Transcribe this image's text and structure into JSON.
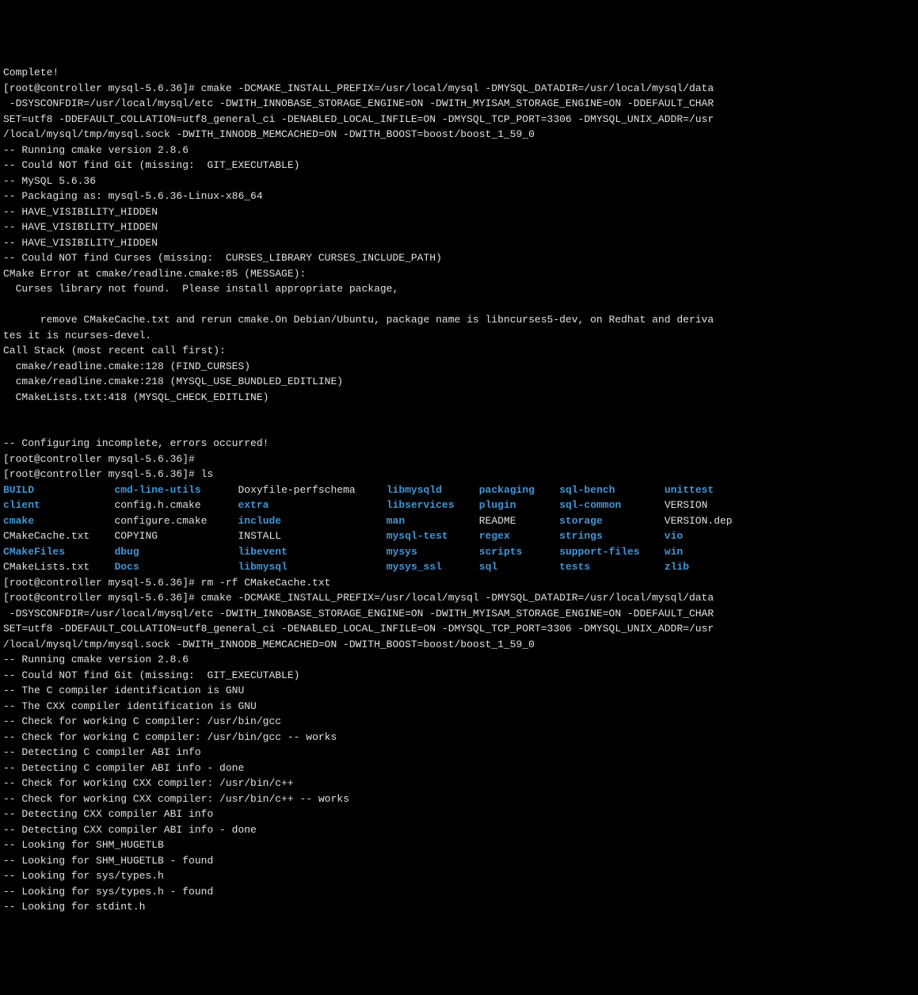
{
  "lines": {
    "l0": "Complete!",
    "l1": "[root@controller mysql-5.6.36]# cmake -DCMAKE_INSTALL_PREFIX=/usr/local/mysql -DMYSQL_DATADIR=/usr/local/mysql/data",
    "l2": " -DSYSCONFDIR=/usr/local/mysql/etc -DWITH_INNOBASE_STORAGE_ENGINE=ON -DWITH_MYISAM_STORAGE_ENGINE=ON -DDEFAULT_CHAR",
    "l3": "SET=utf8 -DDEFAULT_COLLATION=utf8_general_ci -DENABLED_LOCAL_INFILE=ON -DMYSQL_TCP_PORT=3306 -DMYSQL_UNIX_ADDR=/usr",
    "l4": "/local/mysql/tmp/mysql.sock -DWITH_INNODB_MEMCACHED=ON -DWITH_BOOST=boost/boost_1_59_0",
    "l5": "-- Running cmake version 2.8.6",
    "l6": "-- Could NOT find Git (missing:  GIT_EXECUTABLE) ",
    "l7": "-- MySQL 5.6.36",
    "l8": "-- Packaging as: mysql-5.6.36-Linux-x86_64",
    "l9": "-- HAVE_VISIBILITY_HIDDEN",
    "l10": "-- HAVE_VISIBILITY_HIDDEN",
    "l11": "-- HAVE_VISIBILITY_HIDDEN",
    "l12": "-- Could NOT find Curses (missing:  CURSES_LIBRARY CURSES_INCLUDE_PATH) ",
    "l13": "CMake Error at cmake/readline.cmake:85 (MESSAGE):",
    "l14": "  Curses library not found.  Please install appropriate package,",
    "l15": "",
    "l16": "      remove CMakeCache.txt and rerun cmake.On Debian/Ubuntu, package name is libncurses5-dev, on Redhat and deriva",
    "l17": "tes it is ncurses-devel.",
    "l18": "Call Stack (most recent call first):",
    "l19": "  cmake/readline.cmake:128 (FIND_CURSES)",
    "l20": "  cmake/readline.cmake:218 (MYSQL_USE_BUNDLED_EDITLINE)",
    "l21": "  CMakeLists.txt:418 (MYSQL_CHECK_EDITLINE)",
    "l22": "",
    "l23": "",
    "l24": "-- Configuring incomplete, errors occurred!",
    "l25": "[root@controller mysql-5.6.36]# ",
    "l26": "[root@controller mysql-5.6.36]# ls",
    "l27": "[root@controller mysql-5.6.36]# rm -rf CMakeCache.txt ",
    "l28": "[root@controller mysql-5.6.36]# cmake -DCMAKE_INSTALL_PREFIX=/usr/local/mysql -DMYSQL_DATADIR=/usr/local/mysql/data",
    "l29": " -DSYSCONFDIR=/usr/local/mysql/etc -DWITH_INNOBASE_STORAGE_ENGINE=ON -DWITH_MYISAM_STORAGE_ENGINE=ON -DDEFAULT_CHAR",
    "l30": "SET=utf8 -DDEFAULT_COLLATION=utf8_general_ci -DENABLED_LOCAL_INFILE=ON -DMYSQL_TCP_PORT=3306 -DMYSQL_UNIX_ADDR=/usr",
    "l31": "/local/mysql/tmp/mysql.sock -DWITH_INNODB_MEMCACHED=ON -DWITH_BOOST=boost/boost_1_59_0",
    "l32": "-- Running cmake version 2.8.6",
    "l33": "-- Could NOT find Git (missing:  GIT_EXECUTABLE) ",
    "l34": "-- The C compiler identification is GNU",
    "l35": "-- The CXX compiler identification is GNU",
    "l36": "-- Check for working C compiler: /usr/bin/gcc",
    "l37": "-- Check for working C compiler: /usr/bin/gcc -- works",
    "l38": "-- Detecting C compiler ABI info",
    "l39": "-- Detecting C compiler ABI info - done",
    "l40": "-- Check for working CXX compiler: /usr/bin/c++",
    "l41": "-- Check for working CXX compiler: /usr/bin/c++ -- works",
    "l42": "-- Detecting CXX compiler ABI info",
    "l43": "-- Detecting CXX compiler ABI info - done",
    "l44": "-- Looking for SHM_HUGETLB",
    "l45": "-- Looking for SHM_HUGETLB - found",
    "l46": "-- Looking for sys/types.h",
    "l47": "-- Looking for sys/types.h - found",
    "l48": "-- Looking for stdint.h"
  },
  "ls": {
    "r0c0": "BUILD",
    "r0c1": "cmd-line-utils",
    "r0c2": "Doxyfile-perfschema",
    "r0c3": "libmysqld",
    "r0c4": "packaging",
    "r0c5": "sql-bench",
    "r0c6": "unittest",
    "r1c0": "client",
    "r1c1": "config.h.cmake",
    "r1c2": "extra",
    "r1c3": "libservices",
    "r1c4": "plugin",
    "r1c5": "sql-common",
    "r1c6": "VERSION",
    "r2c0": "cmake",
    "r2c1": "configure.cmake",
    "r2c2": "include",
    "r2c3": "man",
    "r2c4": "README",
    "r2c5": "storage",
    "r2c6": "VERSION.dep",
    "r3c0": "CMakeCache.txt",
    "r3c1": "COPYING",
    "r3c2": "INSTALL",
    "r3c3": "mysql-test",
    "r3c4": "regex",
    "r3c5": "strings",
    "r3c6": "vio",
    "r4c0": "CMakeFiles",
    "r4c1": "dbug",
    "r4c2": "libevent",
    "r4c3": "mysys",
    "r4c4": "scripts",
    "r4c5": "support-files",
    "r4c6": "win",
    "r5c0": "CMakeLists.txt",
    "r5c1": "Docs",
    "r5c2": "libmysql",
    "r5c3": "mysys_ssl",
    "r5c4": "sql",
    "r5c5": "tests",
    "r5c6": "zlib"
  },
  "ls_types": {
    "r0c0": "d",
    "r0c1": "d",
    "r0c2": "f",
    "r0c3": "d",
    "r0c4": "d",
    "r0c5": "d",
    "r0c6": "d",
    "r1c0": "d",
    "r1c1": "f",
    "r1c2": "d",
    "r1c3": "d",
    "r1c4": "d",
    "r1c5": "d",
    "r1c6": "f",
    "r2c0": "d",
    "r2c1": "f",
    "r2c2": "d",
    "r2c3": "d",
    "r2c4": "f",
    "r2c5": "d",
    "r2c6": "f",
    "r3c0": "f",
    "r3c1": "f",
    "r3c2": "f",
    "r3c3": "d",
    "r3c4": "d",
    "r3c5": "d",
    "r3c6": "d",
    "r4c0": "d",
    "r4c1": "d",
    "r4c2": "d",
    "r4c3": "d",
    "r4c4": "d",
    "r4c5": "d",
    "r4c6": "d",
    "r5c0": "f",
    "r5c1": "d",
    "r5c2": "d",
    "r5c3": "d",
    "r5c4": "d",
    "r5c5": "d",
    "r5c6": "d"
  },
  "ls_widths": [
    16,
    18,
    22,
    13,
    11,
    15,
    11
  ]
}
